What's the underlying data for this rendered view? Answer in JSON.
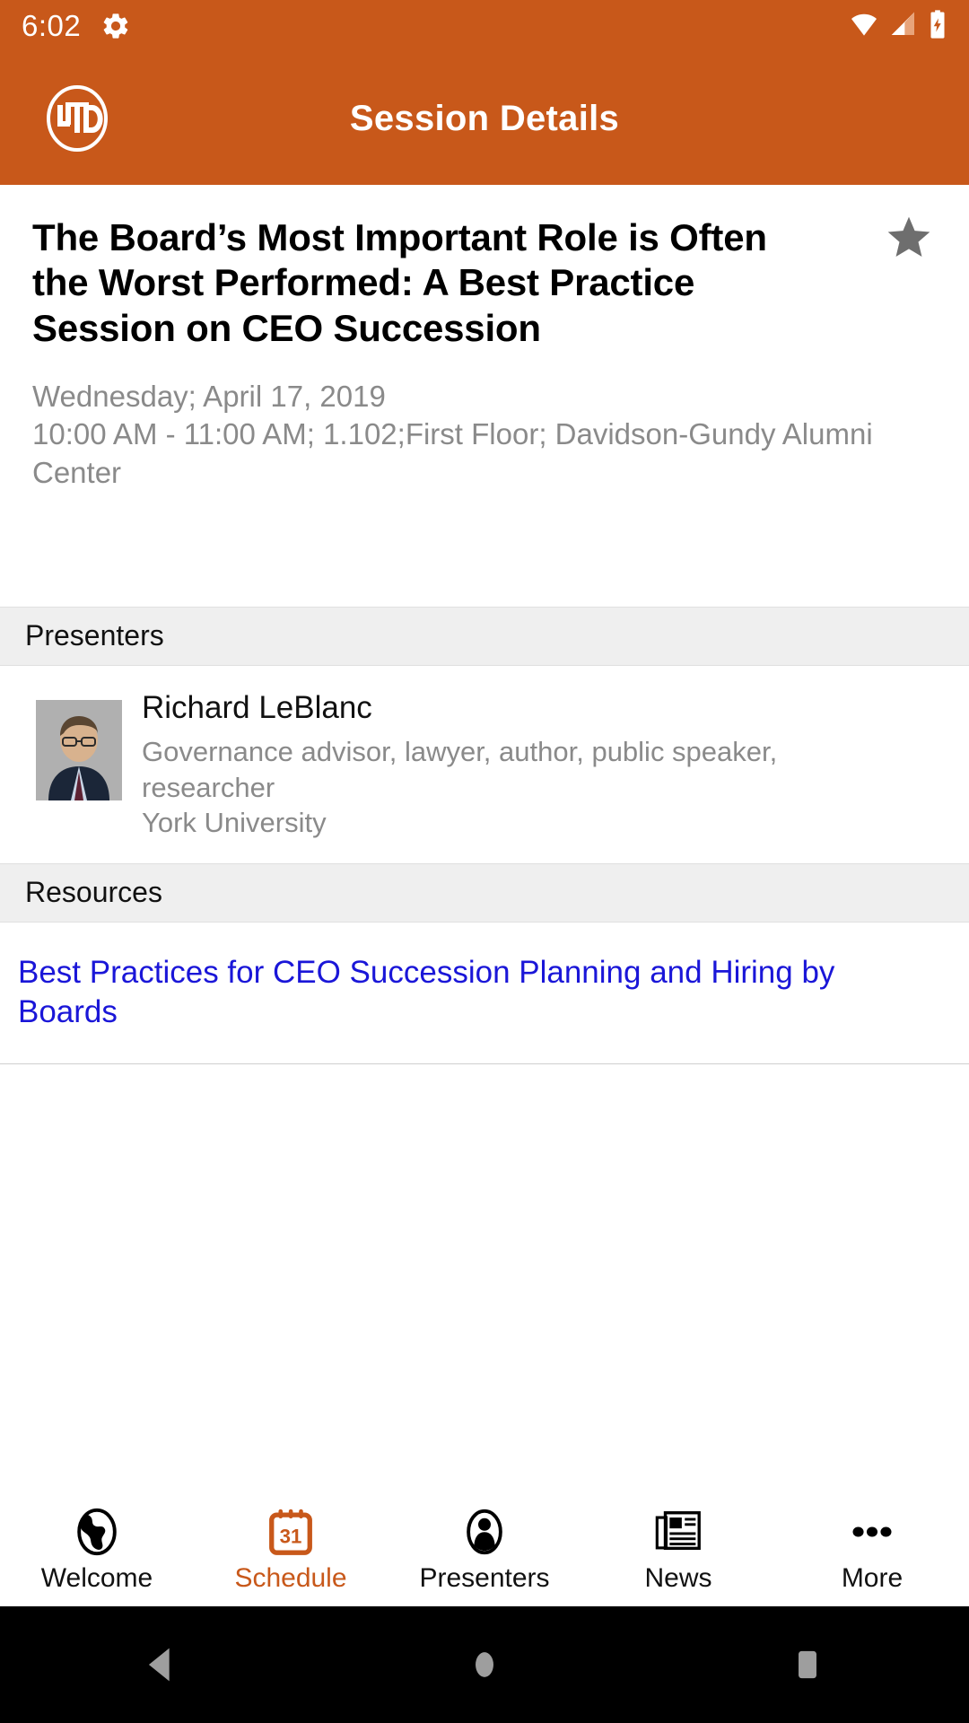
{
  "status_bar": {
    "time": "6:02",
    "gear_icon": "gear-icon",
    "wifi_icon": "wifi-icon",
    "signal_icon": "cell-signal-icon",
    "battery_icon": "battery-charging-icon",
    "background_color": "#C8581A",
    "foreground_color": "#FFFFFF"
  },
  "app_bar": {
    "logo_text": "UTD",
    "logo_icon": "utd-circle-logo",
    "title": "Session Details",
    "background_color": "#C8581A"
  },
  "session": {
    "title": "The Board’s Most Important Role is Often the Worst Performed: A Best Practice Session on CEO Succession",
    "date": "Wednesday; April 17, 2019",
    "time_location": "10:00 AM - 11:00 AM; 1.102;First Floor; Davidson-Gundy Alumni Center",
    "favorite_icon": "star-icon",
    "favorite_color": "#6E6E6E"
  },
  "presenters_section": {
    "header": "Presenters",
    "items": [
      {
        "name": "Richard  LeBlanc",
        "bio": "Governance advisor, lawyer, author, public speaker, researcher",
        "organization": "York University",
        "photo": "presenter-headshot"
      }
    ]
  },
  "resources_section": {
    "header": "Resources",
    "items": [
      {
        "label": "Best Practices for CEO Succession Planning and Hiring by Boards",
        "color": "#1A16D8"
      }
    ]
  },
  "tab_bar": {
    "active_color": "#C8581A",
    "tabs": [
      {
        "label": "Welcome",
        "icon": "globe-icon",
        "active": false
      },
      {
        "label": "Schedule",
        "icon": "calendar-icon",
        "active": true,
        "badge": "31"
      },
      {
        "label": "Presenters",
        "icon": "person-icon",
        "active": false
      },
      {
        "label": "News",
        "icon": "newspaper-icon",
        "active": false
      },
      {
        "label": "More",
        "icon": "ellipsis-icon",
        "active": false
      }
    ]
  },
  "android_nav": {
    "back_icon": "back-triangle-icon",
    "home_icon": "home-circle-icon",
    "recents_icon": "recents-square-icon",
    "background_color": "#000000",
    "icon_color": "#9E9E9E"
  }
}
